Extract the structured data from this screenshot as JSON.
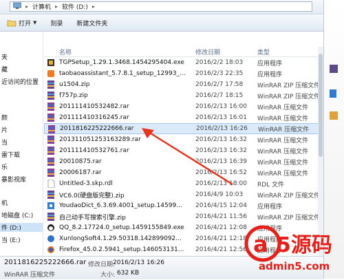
{
  "address": {
    "crumbs": [
      "计算机",
      "软件 (D:)"
    ]
  },
  "toolbar": {
    "open": "打开",
    "burn": "刻录",
    "new_folder": "新建文件夹"
  },
  "nav": {
    "items": [
      "夹",
      "藏",
      "近访问的位置",
      "颜",
      "片",
      "当",
      "雷下载",
      "乐",
      "暴影视库",
      "机",
      "地磁盘 (C:)",
      "件 (D:)",
      "当 (E:)"
    ]
  },
  "columns": {
    "name": "名称",
    "date": "修改日期",
    "type": "类型"
  },
  "files": [
    {
      "name": "TGPSetup_1.29.1.3468.1454295404.exe",
      "date": "2016/2/2 18:03",
      "type": "应用程序",
      "icon": "exe-tgp-icon"
    },
    {
      "name": "taobaoassistant_5.7.8.1_setup_12993_...",
      "date": "2016/2/3 22:35",
      "type": "应用程序",
      "icon": "exe-taobao-icon"
    },
    {
      "name": "u1504.zip",
      "date": "2016/2/7 17:58",
      "type": "WinRAR ZIP 压缩文件",
      "icon": "zip-icon"
    },
    {
      "name": "f757p.zip",
      "date": "2016/2/7 18:15",
      "type": "WinRAR ZIP 压缩文件",
      "icon": "zip-icon"
    },
    {
      "name": "201111410532482.rar",
      "date": "2016/2/13 16:00",
      "type": "WinRAR 压缩文件",
      "icon": "rar-icon"
    },
    {
      "name": "201111410316245.rar",
      "date": "2016/2/13 16:01",
      "type": "WinRAR 压缩文件",
      "icon": "rar-icon"
    },
    {
      "name": "2011816225222666.rar",
      "date": "2016/2/13 16:26",
      "type": "WinRAR 压缩文件",
      "icon": "rar-icon",
      "selected": true
    },
    {
      "name": "201311051253163289.rar",
      "date": "2016/2/13 16:32",
      "type": "WinRAR 压缩文件",
      "icon": "rar-icon"
    },
    {
      "name": "201111410532761.rar",
      "date": "2016/2/13 16:32",
      "type": "WinRAR 压缩文件",
      "icon": "rar-icon"
    },
    {
      "name": "20010875.rar",
      "date": "2016/2/13 16:39",
      "type": "WinRAR 压缩文件",
      "icon": "rar-icon"
    },
    {
      "name": "20006187.rar",
      "date": "2016/2/13 16:52",
      "type": "WinRAR 压缩文件",
      "icon": "rar-icon"
    },
    {
      "name": "Untitled-3.skp.rdl",
      "date": "2016/2/13 18:00",
      "type": "RDL 文件",
      "icon": "file-icon"
    },
    {
      "name": "VC6.0(硬盘版完整).zip",
      "date": "2016/4/9 10:03",
      "type": "WinRAR ZIP 压缩文件",
      "icon": "zip-icon"
    },
    {
      "name": "YoudaoDict_6.3.69.4001_setup.14599...",
      "date": "2016/4/15 12:04",
      "type": "应用程序",
      "icon": "exe-youdao-icon"
    },
    {
      "name": "自己动手写搜索引擎.zip",
      "date": "2016/4/21 11:56",
      "type": "WinRAR ZIP 压缩文件",
      "icon": "zip-icon"
    },
    {
      "name": "QQ_8.2.17724.0_setup.1459155849.exe",
      "date": "2016/4/21 12:08",
      "type": "应用程序",
      "icon": "exe-qq-icon"
    },
    {
      "name": "XunlongSoft4.1.29.50318.142899092...",
      "date": "2016/4/21 12:18",
      "type": "应用程序",
      "icon": "exe-xun-icon"
    },
    {
      "name": "Firefox_45.0.2.5941_setup.146053131...",
      "date": "2016/4/21 12:56",
      "type": "应用程序",
      "icon": "exe-firefox-icon"
    }
  ],
  "status": {
    "name": "2011816225222666.rar",
    "date_label": "修改日期:",
    "date": "2016/2/13 16:26",
    "type": "WinRAR 压缩文件",
    "size_label": "大小:",
    "size": "632 KB"
  },
  "watermark": {
    "brand": "a5源码",
    "url": "admin5.com"
  },
  "colors": {
    "selection": "#dbeafa",
    "header_text": "#5a6d86",
    "arrow": "#e8341c",
    "watermark_red": "#e8201a"
  }
}
